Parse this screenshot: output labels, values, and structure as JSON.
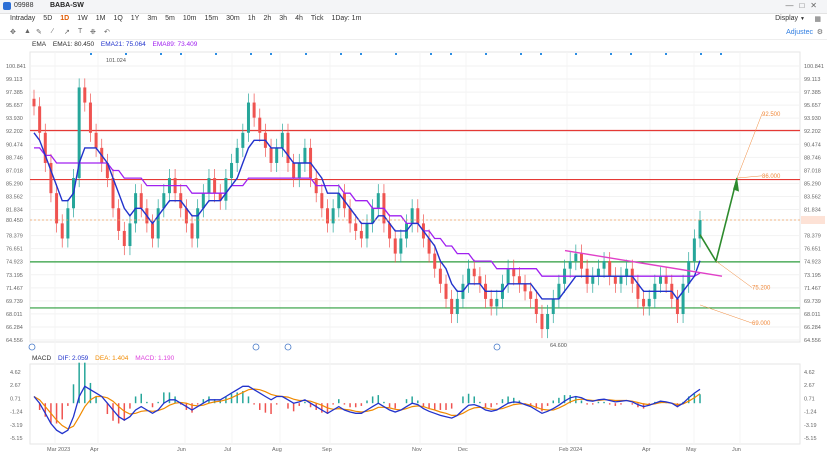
{
  "window": {
    "symbol_code": "09988",
    "symbol_name": "BABA-SW"
  },
  "toolbar": {
    "periods": [
      "Intraday",
      "5D",
      "1D",
      "1W",
      "1M",
      "1Q",
      "1Y",
      "3m",
      "5m",
      "10m",
      "15m",
      "30m",
      "1h",
      "2h",
      "3h",
      "4h",
      "Tick",
      "1Day: 1m"
    ],
    "active_period": "1D",
    "display_label": "Display",
    "adjust_label": "Adjustec"
  },
  "legend": {
    "ema_label": "EMA",
    "ema1": "EMA1: 80.450",
    "ema21": "EMA21: 75.064",
    "ema89": "EMA89: 73.409",
    "ema1_color": "#2b2b2b",
    "ema21_color": "#2233cc",
    "ema89_color": "#a020f0"
  },
  "macd_legend": {
    "macd_label": "MACD",
    "dif": "DIF: 2.059",
    "dea": "DEA: 1.404",
    "macd": "MACD: 1.190",
    "dif_color": "#2233cc",
    "dea_color": "#f08a00",
    "macd_color": "#dd44dd"
  },
  "colors": {
    "up": "#26a69a",
    "down": "#ef5350",
    "resistance": "#e53935",
    "support": "#2e9e3e",
    "annotation": "#f08a3c",
    "trend": "#e040c8"
  },
  "chart_data": [
    {
      "type": "candlestick",
      "title": "BABA-SW",
      "y_ticks": [
        "100.841",
        "99.113",
        "97.385",
        "95.657",
        "93.930",
        "92.202",
        "90.474",
        "88.746",
        "87.018",
        "85.290",
        "83.562",
        "81.834",
        "80.450",
        "78.379",
        "76.651",
        "74.923",
        "73.195",
        "71.467",
        "69.739",
        "68.011",
        "66.284",
        "64.556"
      ],
      "ylim": [
        64.556,
        100.841
      ],
      "x_ticks": [
        "Mar 2023",
        "Apr",
        "Jun",
        "Jul",
        "Aug",
        "Sep",
        "Nov",
        "Dec",
        "Feb 2024",
        "Apr",
        "May",
        "Jun"
      ],
      "last_price": 80.45,
      "high_label": "101.024",
      "low_label": "64.600",
      "horizontal_lines": [
        {
          "value": 92.3,
          "color": "resistance"
        },
        {
          "value": 85.8,
          "color": "resistance"
        },
        {
          "value": 74.9,
          "color": "support"
        },
        {
          "value": 68.8,
          "color": "support"
        }
      ],
      "annotations": [
        "92.500",
        "86.000",
        "75.200",
        "69.000"
      ],
      "close_series": [
        95.5,
        92,
        88,
        84,
        80,
        78,
        82,
        86,
        98,
        96,
        92,
        90,
        88,
        86,
        82,
        79,
        77,
        80,
        84,
        82,
        80,
        78,
        82,
        84,
        86,
        84,
        82,
        80,
        78,
        82,
        84,
        86,
        84,
        83,
        86,
        88,
        90,
        92,
        96,
        94,
        92,
        90,
        88,
        90,
        92,
        88,
        86,
        88,
        90,
        86,
        84,
        82,
        80,
        82,
        84,
        82,
        80,
        79,
        78,
        80,
        82,
        84,
        80,
        78,
        76,
        78,
        80,
        82,
        80,
        78,
        76,
        74,
        72,
        70,
        68,
        70,
        72,
        74,
        73,
        72,
        70,
        69,
        70,
        72,
        74,
        73,
        72,
        71,
        70,
        68,
        66,
        68,
        70,
        72,
        74,
        75,
        76,
        74,
        72,
        73,
        74,
        75,
        73,
        72,
        73,
        74,
        72,
        70,
        69,
        70,
        72,
        73,
        72,
        70,
        68,
        72,
        75,
        78,
        80.45
      ],
      "ema21_series": [
        92,
        91,
        89,
        87,
        85,
        83,
        83,
        84,
        88,
        90,
        90,
        90,
        89,
        88,
        86,
        84,
        82,
        81,
        82,
        82,
        81,
        80,
        81,
        82,
        83,
        83,
        83,
        82,
        81,
        81,
        82,
        83,
        83,
        83,
        84,
        85,
        86,
        88,
        90,
        91,
        91,
        91,
        90,
        90,
        90,
        89,
        88,
        88,
        88,
        88,
        87,
        86,
        84,
        84,
        84,
        83,
        82,
        81,
        80,
        80,
        80,
        81,
        81,
        80,
        79,
        79,
        79,
        80,
        80,
        79,
        78,
        77,
        75,
        74,
        72,
        71,
        71,
        72,
        72,
        72,
        71,
        71,
        71,
        71,
        72,
        72,
        72,
        72,
        72,
        71,
        70,
        70,
        70,
        70,
        71,
        72,
        73,
        73,
        73,
        73,
        73,
        73,
        73,
        73,
        73,
        73,
        73,
        72,
        71,
        71,
        71,
        71,
        71,
        71,
        70,
        71,
        72,
        73,
        75.06
      ],
      "ema89_series": [
        90,
        90,
        89,
        89,
        88,
        88,
        88,
        88,
        88,
        88,
        88,
        88,
        88,
        88,
        87,
        87,
        86,
        86,
        86,
        86,
        85,
        85,
        85,
        85,
        85,
        85,
        85,
        85,
        84,
        84,
        84,
        84,
        84,
        84,
        84,
        85,
        85,
        85,
        86,
        86,
        86,
        86,
        86,
        86,
        86,
        86,
        86,
        86,
        86,
        86,
        85,
        85,
        85,
        85,
        85,
        84,
        84,
        83,
        83,
        83,
        82,
        82,
        82,
        81,
        81,
        81,
        80,
        80,
        80,
        79,
        79,
        78,
        78,
        77,
        77,
        76,
        76,
        76,
        75,
        75,
        75,
        75,
        74,
        74,
        74,
        74,
        74,
        74,
        74,
        74,
        73,
        73,
        73,
        73,
        73,
        73,
        73,
        73,
        73,
        73,
        73,
        73,
        73,
        73,
        73,
        73,
        73,
        73,
        73,
        73,
        73,
        73,
        73,
        73,
        73,
        73,
        73,
        73,
        73.41
      ]
    },
    {
      "type": "line",
      "title": "MACD",
      "y_ticks": [
        "4.62",
        "2.67",
        "0.71",
        "-1.24",
        "-3.19",
        "-5.15"
      ],
      "ylim": [
        -5.15,
        4.62
      ],
      "series": [
        {
          "name": "DIF",
          "values": [
            1,
            0,
            -1.5,
            -3,
            -4,
            -4.5,
            -4,
            -2,
            1,
            2.5,
            2,
            1.5,
            1,
            0,
            -1,
            -2,
            -2.5,
            -2,
            -1,
            -0.5,
            -1,
            -1.5,
            -1,
            0,
            0.5,
            0.5,
            0,
            -0.5,
            -1,
            -0.5,
            0,
            0.5,
            0.5,
            0.5,
            1,
            1.5,
            2,
            2.5,
            2.5,
            2,
            1.5,
            1,
            0.5,
            1,
            1,
            0.5,
            0,
            0.2,
            0.5,
            0,
            -0.5,
            -1,
            -1.5,
            -1,
            -0.5,
            -1,
            -1.3,
            -1.5,
            -1.5,
            -1,
            -0.5,
            0,
            -0.5,
            -1,
            -1.3,
            -1,
            -0.5,
            0,
            -0.2,
            -0.8,
            -1.2,
            -1.5,
            -1.8,
            -2,
            -2.2,
            -1.8,
            -1,
            -0.3,
            -0.2,
            -0.5,
            -1,
            -1.2,
            -1,
            -0.5,
            0,
            0.2,
            0.1,
            -0.2,
            -0.5,
            -1,
            -1.5,
            -1.2,
            -0.8,
            -0.3,
            0.3,
            0.8,
            1,
            0.8,
            0.4,
            0.3,
            0.5,
            0.6,
            0.4,
            0.2,
            0.3,
            0.4,
            0.2,
            -0.2,
            -0.5,
            -0.3,
            0,
            0.3,
            0.2,
            0,
            -0.5,
            0,
            0.8,
            1.5,
            2.06
          ]
        },
        {
          "name": "DEA",
          "values": [
            1,
            0.5,
            -0.5,
            -1.5,
            -2.5,
            -3.3,
            -3.8,
            -3.4,
            -2,
            -0.5,
            0.5,
            1,
            1,
            0.8,
            0.3,
            -0.5,
            -1.2,
            -1.6,
            -1.5,
            -1.2,
            -1.1,
            -1.2,
            -1.1,
            -0.8,
            -0.3,
            0,
            0.1,
            0,
            -0.3,
            -0.4,
            -0.3,
            0,
            0.2,
            0.3,
            0.5,
            0.8,
            1.2,
            1.6,
            2,
            2.1,
            2,
            1.7,
            1.3,
            1.1,
            1,
            0.9,
            0.6,
            0.4,
            0.4,
            0.3,
            0,
            -0.3,
            -0.7,
            -0.9,
            -0.8,
            -0.9,
            -1,
            -1.2,
            -1.3,
            -1.2,
            -1,
            -0.6,
            -0.6,
            -0.7,
            -0.9,
            -1,
            -0.8,
            -0.5,
            -0.4,
            -0.5,
            -0.8,
            -1,
            -1.3,
            -1.5,
            -1.8,
            -1.8,
            -1.5,
            -1,
            -0.7,
            -0.6,
            -0.7,
            -0.9,
            -0.9,
            -0.8,
            -0.5,
            -0.2,
            -0.1,
            -0.1,
            -0.3,
            -0.6,
            -0.9,
            -1,
            -1,
            -0.7,
            -0.3,
            0.2,
            0.5,
            0.6,
            0.5,
            0.4,
            0.4,
            0.5,
            0.5,
            0.4,
            0.4,
            0.4,
            0.3,
            0.1,
            -0.1,
            -0.2,
            -0.1,
            0.1,
            0.1,
            0,
            -0.2,
            -0.1,
            0.3,
            0.8,
            1.4
          ]
        }
      ]
    }
  ]
}
